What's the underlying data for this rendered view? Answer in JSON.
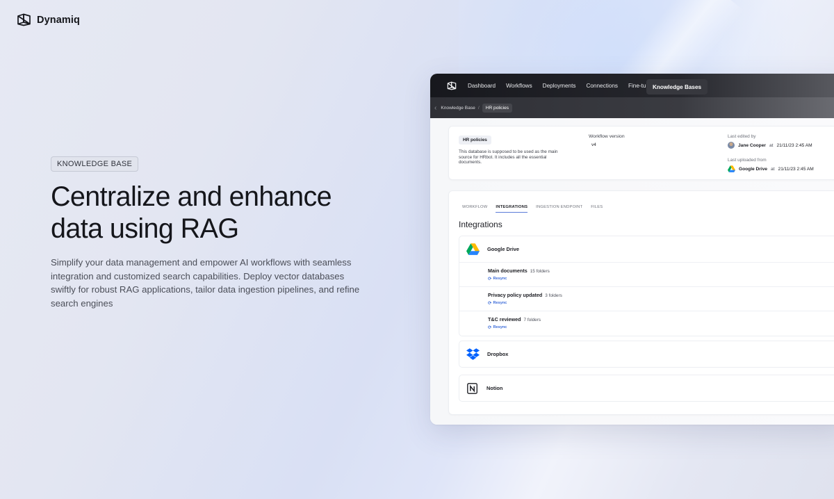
{
  "brand": {
    "name": "Dynamiq"
  },
  "hero": {
    "tag": "KNOWLEDGE BASE",
    "headline_line1": "Centralize and enhance",
    "headline_line2": "data using RAG",
    "subtext": "Simplify your data management and empower AI workflows with seamless integration and customized search capabilities. Deploy vector databases swiftly for robust RAG applications, tailor data ingestion pipelines, and refine search engines"
  },
  "app": {
    "nav": {
      "items": [
        "Dashboard",
        "Workflows",
        "Deployments",
        "Connections",
        "Fine-tuning"
      ],
      "active": "Knowledge Bases"
    },
    "breadcrumb": {
      "parent": "Knowledge Base",
      "separator": "/",
      "current": "HR policies"
    },
    "info": {
      "badge": "HR policies",
      "description": "This database is supposed to be used as the main source for HRbot. It includes all the essential documents.",
      "workflow_version_label": "Workflow version",
      "workflow_version": "v4",
      "last_edited_label": "Last edited by",
      "last_edited_by": "Jane Cooper",
      "at_word": "at",
      "last_edited_time": "21/11/23 2:45 AM",
      "last_uploaded_label": "Last uploaded from",
      "last_uploaded_from": "Google Drive",
      "last_uploaded_time": "21/11/23 2:45 AM"
    },
    "tabs": [
      "WORKFLOW",
      "INTEGRATIONS",
      "INGESTION ENDPOINT",
      "FILES"
    ],
    "active_tab": "INTEGRATIONS",
    "integrations_title": "Integrations",
    "resync_label": "Resync",
    "providers": [
      {
        "name": "Google Drive",
        "icon": "google-drive-icon",
        "folders": [
          {
            "name": "Main documents",
            "count": "15 folders"
          },
          {
            "name": "Privacy policy updated",
            "count": "3 folders"
          },
          {
            "name": "T&C reviewed",
            "count": "7 folders"
          }
        ]
      },
      {
        "name": "Dropbox",
        "icon": "dropbox-icon"
      },
      {
        "name": "Notion",
        "icon": "notion-icon"
      }
    ],
    "colors": {
      "accent": "#3a6ad8",
      "nav_bg": "#17181d"
    }
  }
}
